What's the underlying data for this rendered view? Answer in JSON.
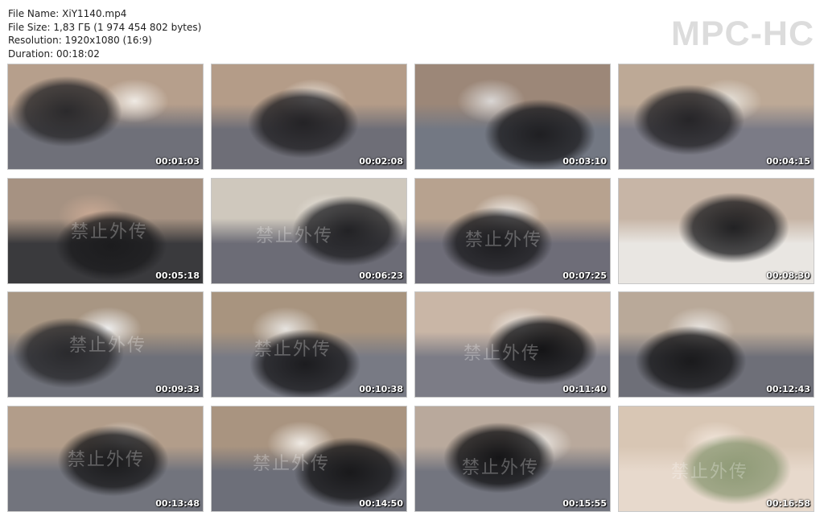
{
  "info": {
    "file_name": "File Name: XiY1140.mp4",
    "file_size": "File Size: 1,83 ГБ (1 974 454 802 bytes)",
    "resolution": "Resolution: 1920x1080 (16:9)",
    "duration": "Duration: 00:18:02"
  },
  "brand": "MPC-HC",
  "watermark": "禁止外传",
  "thumbnails": [
    {
      "time": "00:01:03",
      "palette": [
        "#b69f8c",
        "#6f7079",
        "#2b2a2c",
        "#efeae4"
      ]
    },
    {
      "time": "00:02:08",
      "palette": [
        "#b49c88",
        "#6e6e77",
        "#242326",
        "#f2eee8"
      ]
    },
    {
      "time": "00:03:10",
      "palette": [
        "#9c8778",
        "#737883",
        "#1f1f22",
        "#d9d6d4"
      ]
    },
    {
      "time": "00:04:15",
      "palette": [
        "#bda996",
        "#7b7b86",
        "#262528",
        "#e8e4dd"
      ]
    },
    {
      "time": "00:05:18",
      "palette": [
        "#a69282",
        "#3a3a3d",
        "#1c1c1e",
        "#c9a994"
      ]
    },
    {
      "time": "00:06:23",
      "palette": [
        "#cfc8bd",
        "#6c6c76",
        "#222225",
        "#eeeae3"
      ]
    },
    {
      "time": "00:07:25",
      "palette": [
        "#b7a28f",
        "#6e6d78",
        "#1d1d20",
        "#f5f3f0"
      ]
    },
    {
      "time": "00:08:30",
      "palette": [
        "#c7b5a6",
        "#e9e6e2",
        "#222224",
        "#b39481"
      ]
    },
    {
      "time": "00:09:33",
      "palette": [
        "#a89683",
        "#6e7079",
        "#2a2a2d",
        "#efefef"
      ]
    },
    {
      "time": "00:10:38",
      "palette": [
        "#a8947f",
        "#787a84",
        "#1c1c1f",
        "#e6e3df"
      ]
    },
    {
      "time": "00:11:40",
      "palette": [
        "#c9b6a6",
        "#7c7c86",
        "#141416",
        "#f1eeea"
      ]
    },
    {
      "time": "00:12:43",
      "palette": [
        "#b9a999",
        "#6e6f78",
        "#1a1a1c",
        "#e9e5e1"
      ]
    },
    {
      "time": "00:13:48",
      "palette": [
        "#b29d8a",
        "#72747d",
        "#1a1a1c",
        "#ece8e3"
      ]
    },
    {
      "time": "00:14:50",
      "palette": [
        "#a99480",
        "#6d6f79",
        "#19191b",
        "#efeae4"
      ]
    },
    {
      "time": "00:15:55",
      "palette": [
        "#b9a99c",
        "#73757f",
        "#151517",
        "#eeebe7"
      ]
    },
    {
      "time": "00:16:58",
      "palette": [
        "#d8c6b4",
        "#e7d9cc",
        "#8e9a76",
        "#f3e8de"
      ]
    }
  ]
}
